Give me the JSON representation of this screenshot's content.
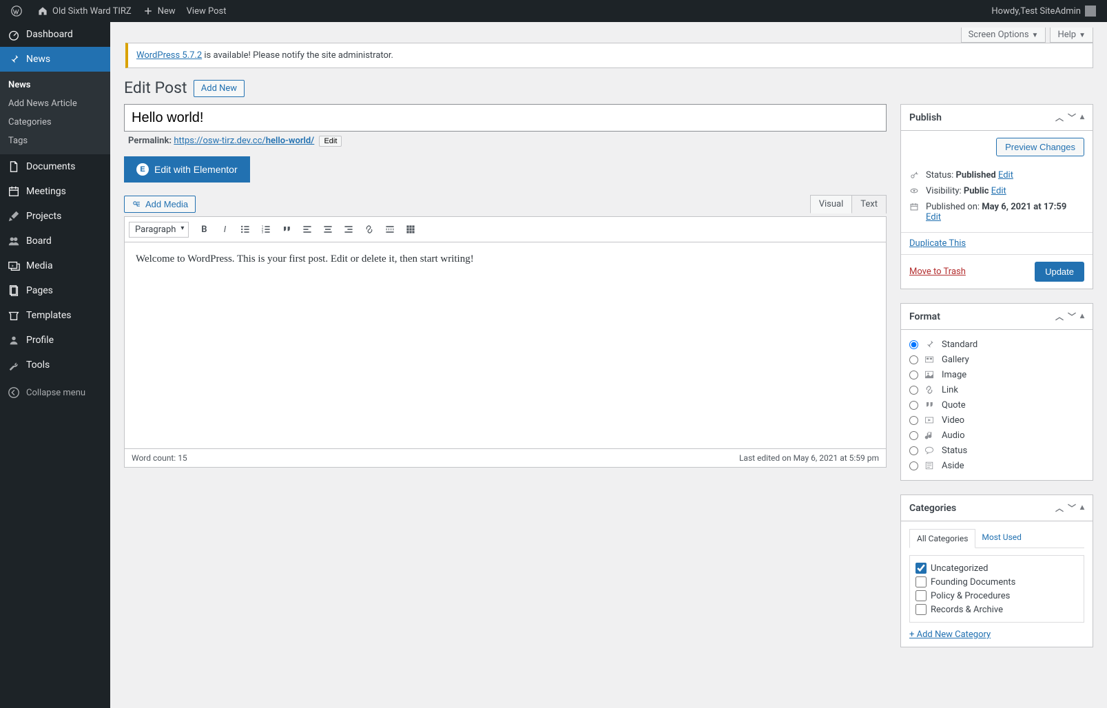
{
  "adminbar": {
    "site_name": "Old Sixth Ward TIRZ",
    "new_label": "New",
    "view_post_label": "View Post",
    "howdy_prefix": "Howdy, ",
    "user_name": "Test SiteAdmin"
  },
  "sidebar": {
    "items": [
      {
        "label": "Dashboard",
        "icon": "dashboard"
      },
      {
        "label": "News",
        "icon": "pin",
        "current": true,
        "submenu": [
          {
            "label": "News",
            "current": true
          },
          {
            "label": "Add News Article"
          },
          {
            "label": "Categories"
          },
          {
            "label": "Tags"
          }
        ]
      },
      {
        "label": "Documents",
        "icon": "document"
      },
      {
        "label": "Meetings",
        "icon": "calendar"
      },
      {
        "label": "Projects",
        "icon": "tools"
      },
      {
        "label": "Board",
        "icon": "groups"
      },
      {
        "label": "Media",
        "icon": "media"
      },
      {
        "label": "Pages",
        "icon": "pages"
      },
      {
        "label": "Templates",
        "icon": "templates"
      },
      {
        "label": "Profile",
        "icon": "user"
      },
      {
        "label": "Tools",
        "icon": "wrench"
      }
    ],
    "collapse_label": "Collapse menu"
  },
  "topbuttons": {
    "screen_options": "Screen Options",
    "help": "Help"
  },
  "notice": {
    "link_text": "WordPress 5.7.2",
    "tail_text": " is available! Please notify the site administrator."
  },
  "page": {
    "title": "Edit Post",
    "add_new": "Add New"
  },
  "post": {
    "title": "Hello world!",
    "permalink_label": "Permalink:",
    "permalink_base": "https://osw-tirz.dev.cc/",
    "permalink_slug": "hello-world/",
    "permalink_edit": "Edit",
    "elementor_btn": "Edit with Elementor",
    "add_media": "Add Media",
    "tab_visual": "Visual",
    "tab_text": "Text",
    "format_select": "Paragraph",
    "body": "Welcome to WordPress. This is your first post. Edit or delete it, then start writing!",
    "word_count_label": "Word count: ",
    "word_count": "15",
    "last_edited": "Last edited on May 6, 2021 at 5:59 pm"
  },
  "publish": {
    "title": "Publish",
    "preview_btn": "Preview Changes",
    "status_label": "Status: ",
    "status_value": "Published",
    "visibility_label": "Visibility: ",
    "visibility_value": "Public",
    "published_label": "Published on: ",
    "published_value": "May 6, 2021 at 17:59",
    "edit_link": "Edit",
    "duplicate": "Duplicate This",
    "trash": "Move to Trash",
    "update": "Update"
  },
  "format": {
    "title": "Format",
    "options": [
      {
        "label": "Standard",
        "icon": "pin",
        "checked": true
      },
      {
        "label": "Gallery",
        "icon": "gallery"
      },
      {
        "label": "Image",
        "icon": "image"
      },
      {
        "label": "Link",
        "icon": "link"
      },
      {
        "label": "Quote",
        "icon": "quote"
      },
      {
        "label": "Video",
        "icon": "video"
      },
      {
        "label": "Audio",
        "icon": "audio"
      },
      {
        "label": "Status",
        "icon": "status"
      },
      {
        "label": "Aside",
        "icon": "aside"
      }
    ]
  },
  "categories": {
    "title": "Categories",
    "tab_all": "All Categories",
    "tab_most": "Most Used",
    "items": [
      {
        "label": "Uncategorized",
        "checked": true
      },
      {
        "label": "Founding Documents"
      },
      {
        "label": "Policy & Procedures"
      },
      {
        "label": "Records & Archive"
      }
    ],
    "add_new": "+ Add New Category"
  }
}
